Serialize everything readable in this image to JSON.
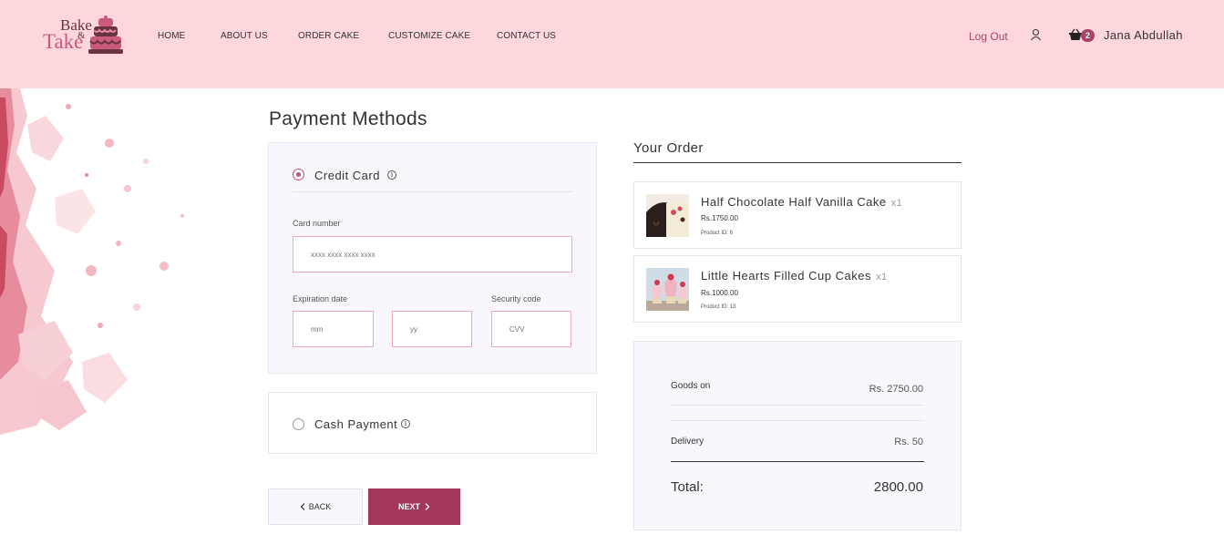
{
  "header": {
    "logo": {
      "word1": "Bake",
      "amp": "&",
      "word2": "Take"
    },
    "nav": [
      {
        "label": "HOME"
      },
      {
        "label": "ABOUT US"
      },
      {
        "label": "ORDER CAKE"
      },
      {
        "label": "CUSTOMIZE CAKE"
      },
      {
        "label": "CONTACT US"
      }
    ],
    "logout_label": "Log Out",
    "cart_count": "2",
    "username": "Jana Abdullah",
    "icons": {
      "user": "user-icon",
      "cart": "basket-icon"
    }
  },
  "payment": {
    "title": "Payment Methods",
    "credit_card": {
      "label": "Credit Card",
      "selected": true,
      "card_number_label": "Card number",
      "card_number_placeholder": "xxxx xxxx xxxx xxxx",
      "expiration_label": "Expiration date",
      "month_placeholder": "mm",
      "year_placeholder": "yy",
      "security_label": "Security code",
      "cvv_placeholder": "CVV"
    },
    "cash": {
      "label": "Cash Payment",
      "selected": false
    },
    "back_label": "BACK",
    "next_label": "NEXT"
  },
  "order": {
    "title": "Your Order",
    "items": [
      {
        "name": "Half Chocolate Half Vanilla Cake",
        "qty": "x1",
        "price": "Rs.1750.00",
        "product_id": "Product ID: 6"
      },
      {
        "name": "Little Hearts Filled Cup Cakes",
        "qty": "x1",
        "price": "Rs.1000.00",
        "product_id": "Product ID: 13"
      }
    ],
    "summary": {
      "goods_label": "Goods on",
      "goods_value": "Rs. 2750.00",
      "delivery_label": "Delivery",
      "delivery_value": "Rs. 50",
      "total_label": "Total:",
      "total_value": "2800.00"
    }
  },
  "colors": {
    "header_bg": "#fdd7dc",
    "accent": "#a3365d",
    "panel_bg": "#f9f7fd",
    "input_border": "#f0a9b9"
  }
}
